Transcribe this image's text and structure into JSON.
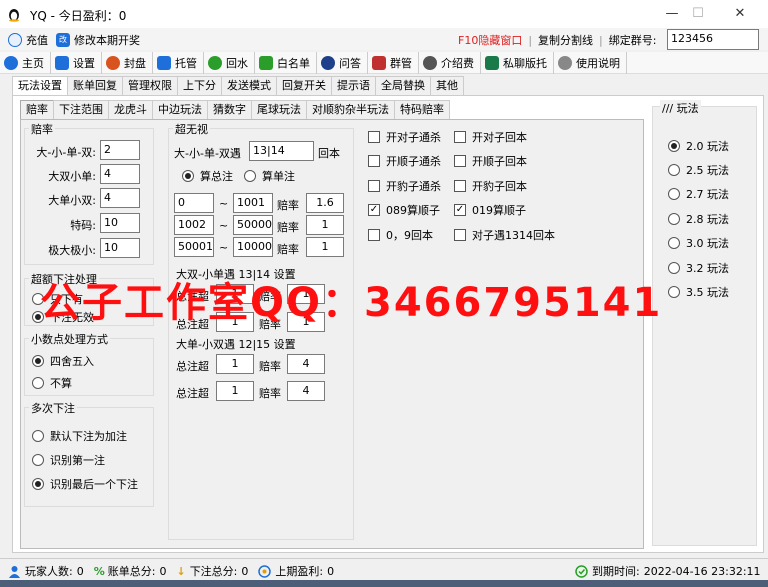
{
  "window": {
    "title": "YQ - 今日盈利：0",
    "min": "—",
    "max": "☐",
    "close": "✕"
  },
  "topbar": {
    "recharge": "充值",
    "edit_period": "修改本期开奖",
    "f10": "F10隐藏窗口",
    "copy_line": "复制分割线",
    "bind_label": "绑定群号:",
    "bind_value": "123456"
  },
  "toolbar": [
    {
      "label": "主页",
      "icon": "home-icon",
      "color": "#1e6fd9"
    },
    {
      "label": "设置",
      "icon": "gear-icon",
      "color": "#1e6fd9"
    },
    {
      "label": "封盘",
      "icon": "clock-icon",
      "color": "#d9531e"
    },
    {
      "label": "托管",
      "icon": "person-icon",
      "color": "#1e6fd9"
    },
    {
      "label": "回水",
      "icon": "cycle-icon",
      "color": "#2a9d2a"
    },
    {
      "label": "白名单",
      "icon": "users-icon",
      "color": "#2a9d2a"
    },
    {
      "label": "问答",
      "icon": "qa-icon",
      "color": "#1e3f8a"
    },
    {
      "label": "群管",
      "icon": "group-icon",
      "color": "#c03030"
    },
    {
      "label": "介绍费",
      "icon": "table-icon",
      "color": "#555555"
    },
    {
      "label": "私聊版托",
      "icon": "chat-icon",
      "color": "#1a7a4a"
    },
    {
      "label": "使用说明",
      "icon": "help-icon",
      "color": "#888888"
    }
  ],
  "tabs1": [
    "玩法设置",
    "账单回复",
    "管理权限",
    "上下分",
    "发送模式",
    "回复开关",
    "提示语",
    "全局替换",
    "其他"
  ],
  "tabs2": [
    "赔率",
    "下注范围",
    "龙虎斗",
    "中边玩法",
    "猜数字",
    "尾球玩法",
    "对顺豹杂半玩法",
    "特码赔率"
  ],
  "odds": {
    "title": "赔率",
    "rows": [
      {
        "label": "大-小-单-双:",
        "value": "2"
      },
      {
        "label": "大双小单:",
        "value": "4"
      },
      {
        "label": "大单小双:",
        "value": "4"
      },
      {
        "label": "特码:",
        "value": "10"
      },
      {
        "label": "极大极小:",
        "value": "10"
      }
    ]
  },
  "overlimit": {
    "title": "超额下注处理",
    "options": [
      "只下有",
      "下注无效"
    ],
    "selected": 1
  },
  "decimal": {
    "title": "小数点处理方式",
    "options": [
      "四舍五入",
      "不算"
    ],
    "selected": 0
  },
  "multi": {
    "title": "多次下注",
    "options": [
      "默认下注为加注",
      "识别第一注",
      "识别最后一个下注"
    ],
    "selected": 2
  },
  "super": {
    "title": "超无视",
    "line_label": "大-小-单-双遇",
    "line_value": "13|14",
    "line_suffix": "回本",
    "radio": [
      "算总注",
      "算单注"
    ],
    "radio_selected": 0,
    "ranges": [
      {
        "from": "0",
        "to": "1001",
        "label": "赔率",
        "rate": "1.6"
      },
      {
        "from": "1002",
        "to": "50000",
        "label": "赔率",
        "rate": "1"
      },
      {
        "from": "50001",
        "to": "100000",
        "label": "赔率",
        "rate": "1"
      }
    ],
    "tilde": "~",
    "sec2_title": "大双-小单遇 13|14 设置",
    "sec2": [
      {
        "label": "总注超",
        "value": "1",
        "rate_label": "赔率",
        "rate": "1"
      },
      {
        "label": "总注超",
        "value": "1",
        "rate_label": "赔率",
        "rate": "1"
      }
    ],
    "sec3_title": "大单-小双遇 12|15 设置",
    "sec3": [
      {
        "label": "总注超",
        "value": "1",
        "rate_label": "赔率",
        "rate": "4"
      },
      {
        "label": "总注超",
        "value": "1",
        "rate_label": "赔率",
        "rate": "4"
      }
    ]
  },
  "checks": [
    {
      "label": "开对子通杀",
      "checked": false
    },
    {
      "label": "开对子回本",
      "checked": false
    },
    {
      "label": "开顺子通杀",
      "checked": false
    },
    {
      "label": "开顺子回本",
      "checked": false
    },
    {
      "label": "开豹子通杀",
      "checked": false
    },
    {
      "label": "开豹子回本",
      "checked": false
    },
    {
      "label": "089算顺子",
      "checked": true
    },
    {
      "label": "019算顺子",
      "checked": true
    },
    {
      "label": "0，9回本",
      "checked": false
    },
    {
      "label": "对子遇1314回本",
      "checked": false
    }
  ],
  "play": {
    "title": "/// 玩法",
    "options": [
      "2.0 玩法",
      "2.5 玩法",
      "2.7 玩法",
      "2.8 玩法",
      "3.0 玩法",
      "3.2 玩法",
      "3.5 玩法"
    ],
    "selected": 0
  },
  "watermark": "公子工作室QQ：3466795141",
  "status": {
    "players_label": "玩家人数:",
    "players": "0",
    "bill_label": "账单总分:",
    "bill": "0",
    "bet_label": "下注总分:",
    "bet": "0",
    "profit_label": "上期盈利:",
    "profit": "0",
    "expire_label": "到期时间:",
    "expire": "2022-04-16 23:32:11"
  }
}
